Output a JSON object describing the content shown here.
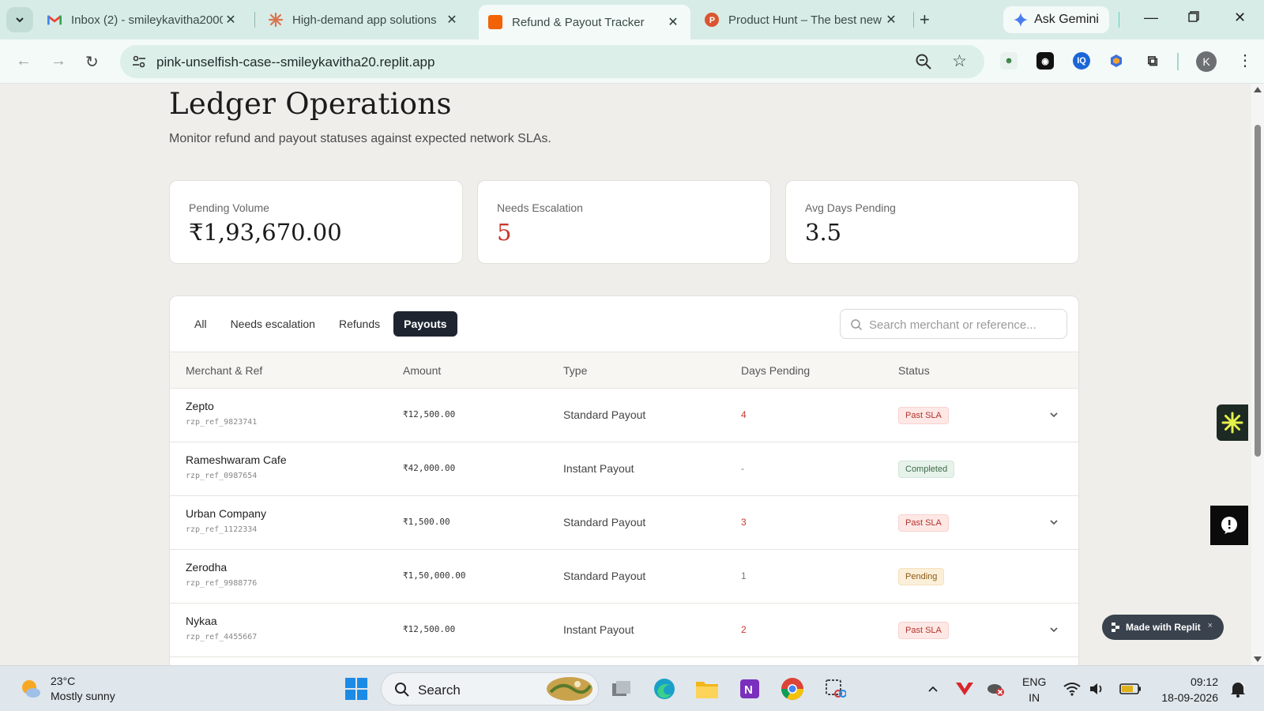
{
  "browser": {
    "tabs": [
      {
        "title": "Inbox (2) - smileykavitha2000",
        "icon": "gmail-icon"
      },
      {
        "title": "High-demand app solutions",
        "icon": "claude-icon"
      },
      {
        "title": "Refund & Payout Tracker",
        "icon": "replit-icon"
      },
      {
        "title": "Product Hunt – The best new",
        "icon": "producthunt-icon"
      }
    ],
    "active_tab": "Refund & Payout Tracker",
    "gemini_label": "Ask Gemini",
    "url": "pink-unselfish-case--smileykavitha20.replit.app",
    "profile_initial": "K"
  },
  "page": {
    "title": "Ledger Operations",
    "subtitle": "Monitor refund and payout statuses against expected network SLAs."
  },
  "stats": [
    {
      "label": "Pending Volume",
      "value": "₹1,93,670.00"
    },
    {
      "label": "Needs Escalation",
      "value": "5"
    },
    {
      "label": "Avg Days Pending",
      "value": "3.5"
    }
  ],
  "filters": {
    "tabs": [
      "All",
      "Needs escalation",
      "Refunds",
      "Payouts"
    ],
    "active": "Payouts",
    "search_placeholder": "Search merchant or reference..."
  },
  "table": {
    "columns": [
      "Merchant & Ref",
      "Amount",
      "Type",
      "Days Pending",
      "Status"
    ],
    "rows": [
      {
        "merchant": "Zepto",
        "ref": "rzp_ref_9823741",
        "amount": "₹12,500.00",
        "type": "Standard Payout",
        "days": "4",
        "status": "Past SLA"
      },
      {
        "merchant": "Rameshwaram Cafe",
        "ref": "rzp_ref_0987654",
        "amount": "₹42,000.00",
        "type": "Instant Payout",
        "days": "-",
        "status": "Completed"
      },
      {
        "merchant": "Urban Company",
        "ref": "rzp_ref_1122334",
        "amount": "₹1,500.00",
        "type": "Standard Payout",
        "days": "3",
        "status": "Past SLA"
      },
      {
        "merchant": "Zerodha",
        "ref": "rzp_ref_9988776",
        "amount": "₹1,50,000.00",
        "type": "Standard Payout",
        "days": "1",
        "status": "Pending"
      },
      {
        "merchant": "Nykaa",
        "ref": "rzp_ref_4455667",
        "amount": "₹12,500.00",
        "type": "Instant Payout",
        "days": "2",
        "status": "Past SLA"
      }
    ]
  },
  "made_with": {
    "label": "Made with Replit",
    "close": "×"
  },
  "taskbar": {
    "weather_temp": "23°C",
    "weather_desc": "Mostly sunny",
    "search_label": "Search",
    "lang_top": "ENG",
    "lang_bottom": "IN",
    "time": "09:12",
    "date": "18-09-2026"
  },
  "colors": {
    "accent_dark": "#1e2530",
    "alert_red": "#c8382c",
    "chrome_mint": "#d8ece7"
  }
}
